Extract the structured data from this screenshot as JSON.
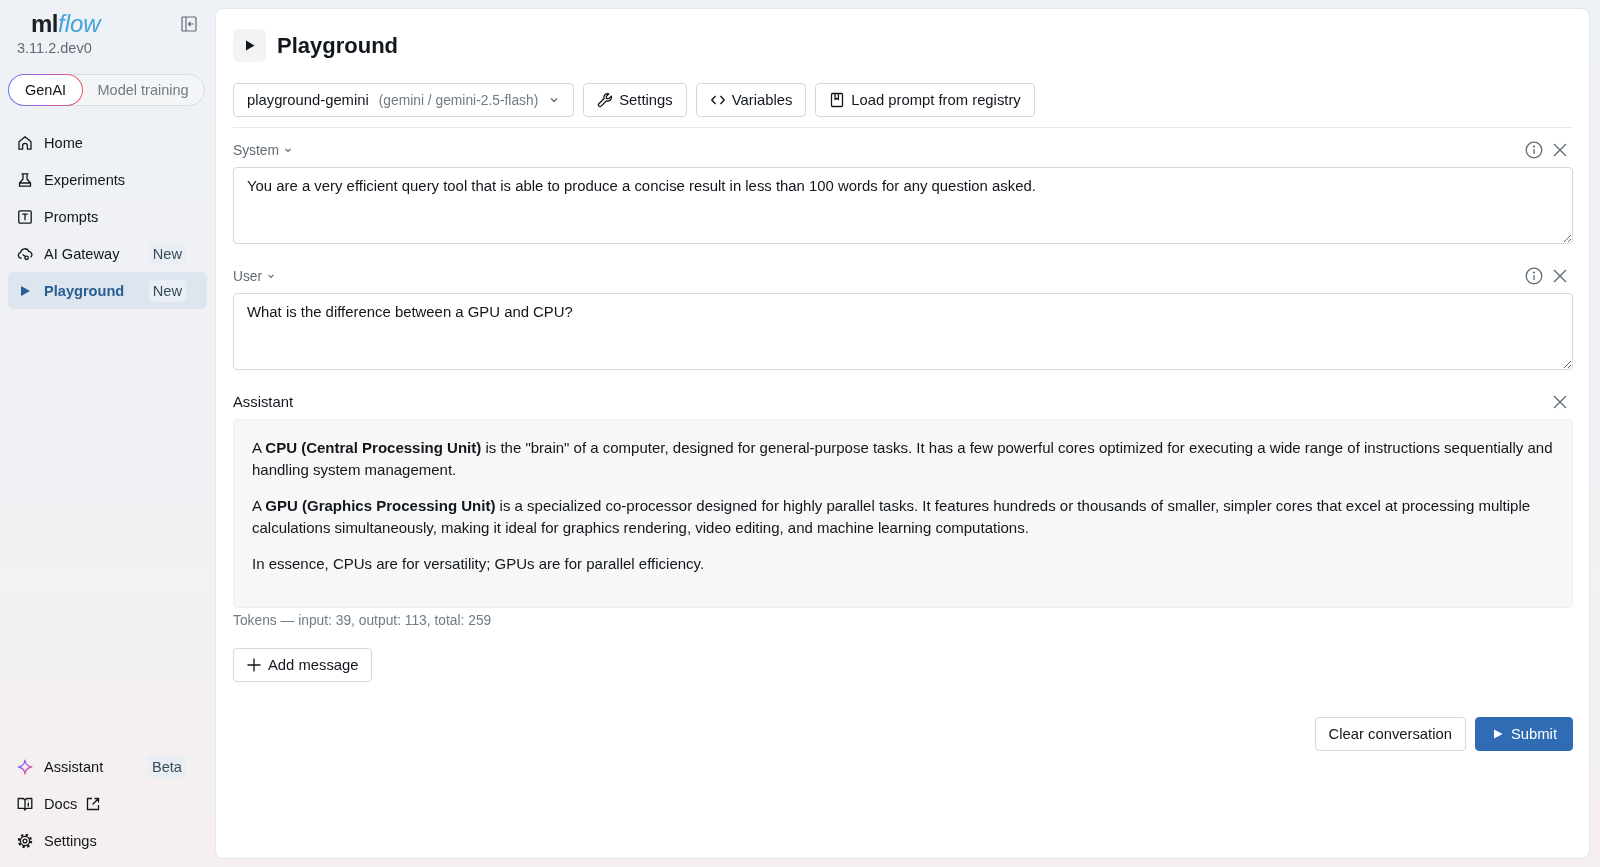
{
  "sidebar": {
    "logo": {
      "text": "ml",
      "accent": "flow"
    },
    "version": "3.11.2.dev0",
    "mode_switch": [
      {
        "label": "GenAI",
        "selected": true
      },
      {
        "label": "Model training",
        "selected": false
      }
    ],
    "nav": [
      {
        "label": "Home",
        "selected": false
      },
      {
        "label": "Experiments",
        "selected": false
      },
      {
        "label": "Prompts",
        "selected": false
      },
      {
        "label": "AI Gateway",
        "badge": "New",
        "selected": false
      },
      {
        "label": "Playground",
        "badge": "New",
        "selected": true
      }
    ],
    "footer_nav": [
      {
        "label": "Assistant",
        "badge": "Beta"
      },
      {
        "label": "Docs"
      },
      {
        "label": "Settings"
      }
    ]
  },
  "header": {
    "title": "Playground"
  },
  "toolbar": {
    "model_select": {
      "value": "playground-gemini",
      "detail": "(gemini / gemini-2.5-flash)"
    },
    "buttons": [
      "Settings",
      "Variables",
      "Load prompt from registry"
    ]
  },
  "messages": [
    {
      "kind": "input",
      "role": "System",
      "value": "You are a very efficient query tool that is able to produce a concise result in less than 100 words for any question asked."
    },
    {
      "kind": "input",
      "role": "User",
      "value": "What is the difference between a GPU and CPU?"
    },
    {
      "kind": "response",
      "role": "Assistant",
      "paragraphs": [
        "A **CPU (Central Processing Unit)** is the \"brain\" of a computer, designed for general-purpose tasks. It has a few powerful cores optimized for executing a wide range of instructions sequentially and handling system management.",
        "A **GPU (Graphics Processing Unit)** is a specialized co-processor designed for highly parallel tasks. It features hundreds or thousands of smaller, simpler cores that excel at processing multiple calculations simultaneously, making it ideal for graphics rendering, video editing, and machine learning computations.",
        "In essence, CPUs are for versatility; GPUs are for parallel efficiency."
      ]
    }
  ],
  "token_usage": "Tokens — input: 39, output: 113, total: 259",
  "add_message": "Add message",
  "actions": {
    "clear": "Clear conversation",
    "submit": "Submit"
  }
}
